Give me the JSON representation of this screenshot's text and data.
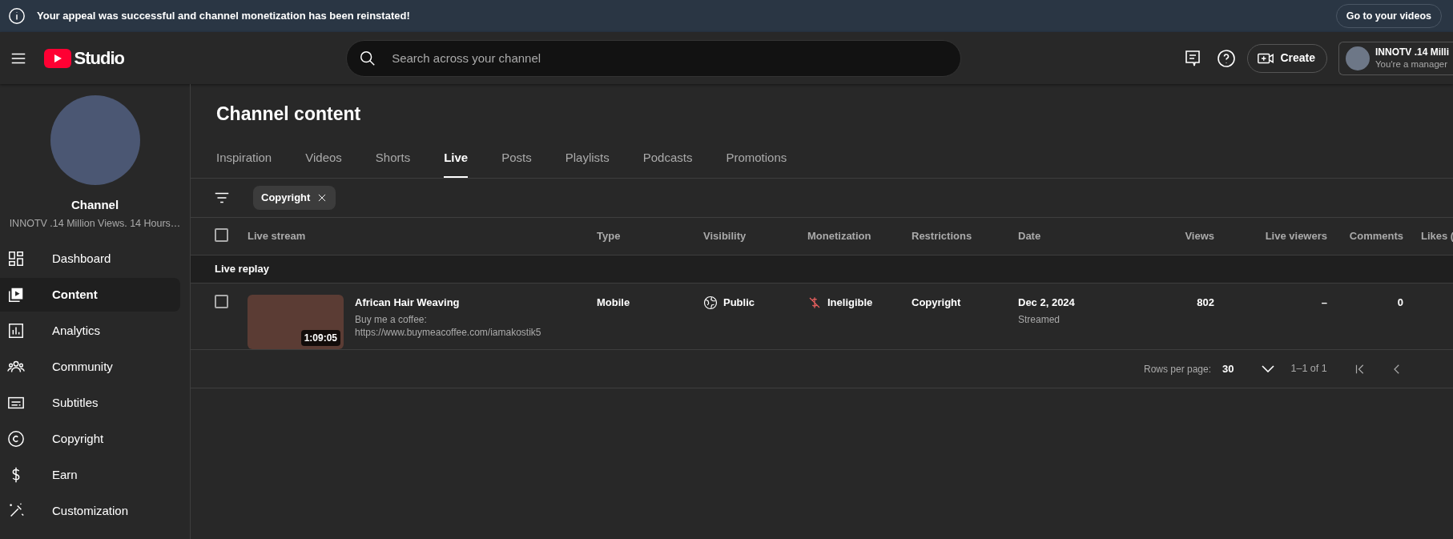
{
  "banner": {
    "message": "Your appeal was successful and channel monetization has been reinstated!",
    "button": "Go to your videos"
  },
  "header": {
    "logo_text": "Studio",
    "search_placeholder": "Search across your channel",
    "create_label": "Create",
    "account": {
      "name": "INNOTV .14 Milli",
      "role": "You're a manager"
    }
  },
  "sidebar": {
    "channel_title": "Channel",
    "channel_subtitle": "INNOTV .14 Million Views. 14 Hours…",
    "items": [
      {
        "label": "Dashboard",
        "selected": false
      },
      {
        "label": "Content",
        "selected": true
      },
      {
        "label": "Analytics",
        "selected": false
      },
      {
        "label": "Community",
        "selected": false
      },
      {
        "label": "Subtitles",
        "selected": false
      },
      {
        "label": "Copyright",
        "selected": false
      },
      {
        "label": "Earn",
        "selected": false
      },
      {
        "label": "Customization",
        "selected": false
      }
    ]
  },
  "page_title": "Channel content",
  "tabs": [
    {
      "label": "Inspiration",
      "selected": false
    },
    {
      "label": "Videos",
      "selected": false
    },
    {
      "label": "Shorts",
      "selected": false
    },
    {
      "label": "Live",
      "selected": true
    },
    {
      "label": "Posts",
      "selected": false
    },
    {
      "label": "Playlists",
      "selected": false
    },
    {
      "label": "Podcasts",
      "selected": false
    },
    {
      "label": "Promotions",
      "selected": false
    }
  ],
  "filters": [
    {
      "label": "Copyright"
    }
  ],
  "table": {
    "select_all_checked": false,
    "columns": [
      {
        "label": "Live stream"
      },
      {
        "label": "Type"
      },
      {
        "label": "Visibility"
      },
      {
        "label": "Monetization"
      },
      {
        "label": "Restrictions"
      },
      {
        "label": "Date"
      },
      {
        "label": "Views"
      },
      {
        "label": "Live viewers"
      },
      {
        "label": "Comments"
      },
      {
        "label": "Likes ("
      }
    ],
    "groups": [
      {
        "label": "Live replay",
        "rows": [
          {
            "checked": false,
            "title": "African Hair Weaving",
            "description": "Buy me a coffee:\nhttps://www.buymeacoffee.com/iamakostik5",
            "duration": "1:09:05",
            "type": "Mobile",
            "visibility": "Public",
            "monetization": "Ineligible",
            "restrictions": "Copyright",
            "date": "Dec 2, 2024",
            "date_note": "Streamed",
            "views": "802",
            "live_viewers": "–",
            "comments": "0"
          }
        ]
      }
    ]
  },
  "pagination": {
    "rows_label": "Rows per page:",
    "rows_value": "30",
    "range": "1–1 of 1"
  }
}
